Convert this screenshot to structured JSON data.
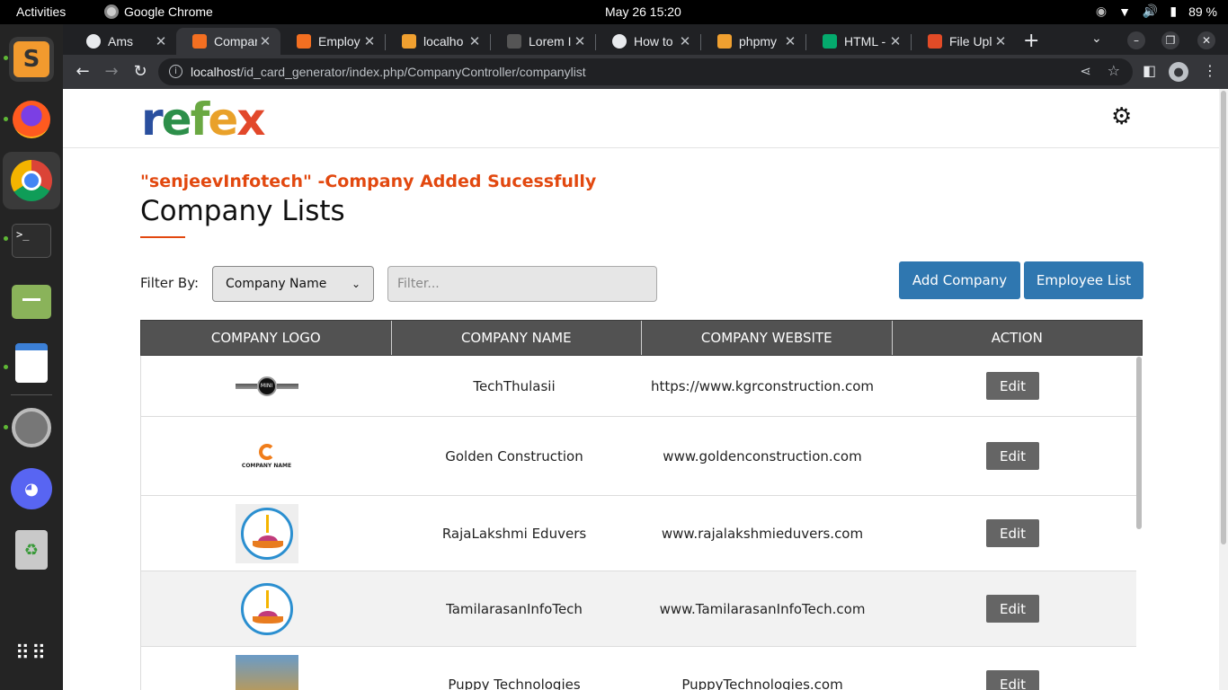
{
  "system": {
    "activities": "Activities",
    "app_name": "Google Chrome",
    "clock": "May 26  15:20",
    "battery": "89 %"
  },
  "tabs": [
    {
      "title": "Ams",
      "color": "#e8eaed"
    },
    {
      "title": "Compar",
      "color": "#f36f21"
    },
    {
      "title": "Employ",
      "color": "#f36f21"
    },
    {
      "title": "localho",
      "color": "#f0a030"
    },
    {
      "title": "Lorem I",
      "color": "#555555"
    },
    {
      "title": "How to",
      "color": "#e8eaed"
    },
    {
      "title": "phpmy",
      "color": "#f0a030"
    },
    {
      "title": "HTML -",
      "color": "#04aa6d"
    },
    {
      "title": "File Upl",
      "color": "#e24b27"
    }
  ],
  "address": {
    "host": "localhost",
    "path": "/id_card_generator/index.php/CompanyController/companylist"
  },
  "site": {
    "logo_letters": [
      "r",
      "e",
      "f",
      "e",
      "x"
    ]
  },
  "page": {
    "success_message": "\"senjeevInfotech\" -Company Added Sucessfully",
    "heading": "Company Lists",
    "filter_label": "Filter By:",
    "filter_selected": "Company Name",
    "filter_placeholder": "Filter...",
    "add_company": "Add Company",
    "employee_list": "Employee List"
  },
  "table": {
    "headers": [
      "COMPANY LOGO",
      "COMPANY NAME",
      "COMPANY WEBSITE",
      "ACTION"
    ],
    "rows": [
      {
        "name": "TechThulasii",
        "website": "https://www.kgrconstruction.com",
        "action": "Edit",
        "logo_text": "MINI"
      },
      {
        "name": "Golden Construction",
        "website": "www.goldenconstruction.com",
        "action": "Edit",
        "logo_text": "COMPANY NAME"
      },
      {
        "name": "RajaLakshmi Eduvers",
        "website": "www.rajalakshmieduvers.com",
        "action": "Edit",
        "logo_text": ""
      },
      {
        "name": "TamilarasanInfoTech",
        "website": "www.TamilarasanInfoTech.com",
        "action": "Edit",
        "logo_text": ""
      },
      {
        "name": "Puppy Technologies",
        "website": "PuppyTechnologies.com",
        "action": "Edit",
        "logo_text": ""
      }
    ]
  }
}
